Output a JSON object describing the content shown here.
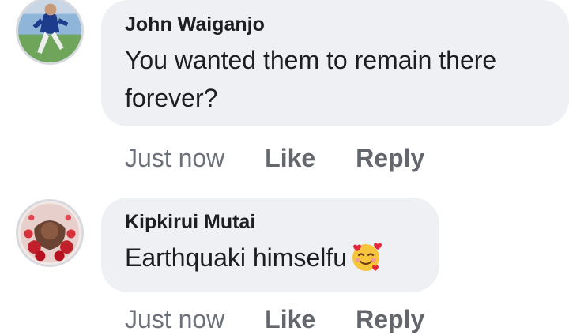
{
  "comments": [
    {
      "author": "John Waiganjo",
      "text": "You wanted them to remain there forever?",
      "time": "Just now",
      "like_label": "Like",
      "reply_label": "Reply"
    },
    {
      "author": "Kipkirui Mutai",
      "text": "Earthquaki himselfu",
      "emoji": "smiling-face-with-hearts-icon",
      "time": "Just now",
      "like_label": "Like",
      "reply_label": "Reply"
    }
  ],
  "colors": {
    "bubble": "#eff0f4",
    "text": "#1c1e21",
    "meta": "#6c7079"
  }
}
